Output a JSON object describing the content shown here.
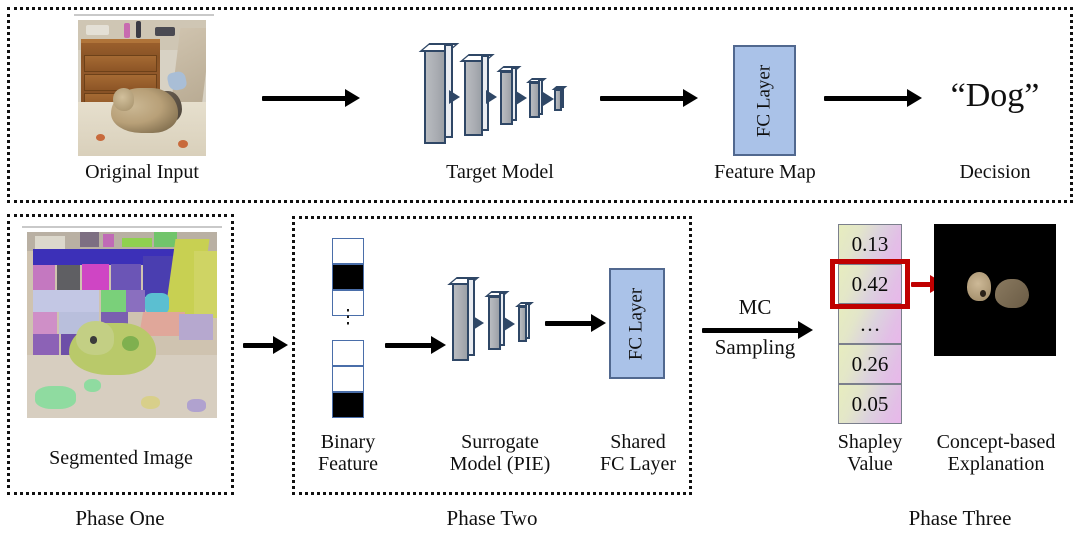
{
  "figure": {
    "title": "Three-phase concept-based explanation pipeline"
  },
  "phases": [
    {
      "name": "phase-one",
      "label": "Phase One"
    },
    {
      "name": "phase-two",
      "label": "Phase Two"
    },
    {
      "name": "phase-three",
      "label": "Phase Three"
    }
  ],
  "top_row": {
    "original_input": {
      "caption": "Original Input",
      "image": "dog-on-bed-photo"
    },
    "target_model": {
      "caption": "Target Model",
      "layers": 5
    },
    "feature_map": {
      "caption": "Feature Map",
      "box_label": "FC\nLayer"
    },
    "decision": {
      "caption": "Decision",
      "value": "“Dog”"
    },
    "arrows": [
      "arrow-input-to-model",
      "arrow-model-to-fc",
      "arrow-fc-to-decision"
    ]
  },
  "bottom_row": {
    "segmented_image": {
      "caption": "Segmented Image",
      "image": "segmented-dog-photo"
    },
    "binary_feature": {
      "caption": "Binary\nFeature",
      "top_cells": [
        "white",
        "black",
        "white"
      ],
      "bottom_cells": [
        "white",
        "white",
        "black"
      ],
      "ellipsis": "⋮"
    },
    "surrogate_model": {
      "caption": "Surrogate\nModel (PIE)",
      "layers": 3
    },
    "shared_fc": {
      "caption": "Shared\nFC Layer",
      "box_label": "FC\nLayer"
    },
    "mc_sampling": {
      "label_top": "MC",
      "label_bottom": "Sampling"
    },
    "shapley": {
      "caption": "Shapley\nValue",
      "cells": [
        "0.13",
        "0.42",
        "…",
        "0.26",
        "0.05"
      ],
      "highlighted_index": 1,
      "highlight_color": "#c00000"
    },
    "explanation": {
      "caption": "Concept-based\nExplanation",
      "image": "masked-dog-on-black"
    },
    "arrows": [
      "arrow-seg-to-binary",
      "arrow-binary-to-surrogate",
      "arrow-surrogate-to-fc",
      "arrow-mc-sampling",
      "arrow-shapley-to-explanation"
    ]
  },
  "colors": {
    "fc_fill": "#aac2e8",
    "fc_stroke": "#51688f",
    "slab_stroke": "#2f4766",
    "highlight": "#c00000",
    "border": "#111111"
  }
}
